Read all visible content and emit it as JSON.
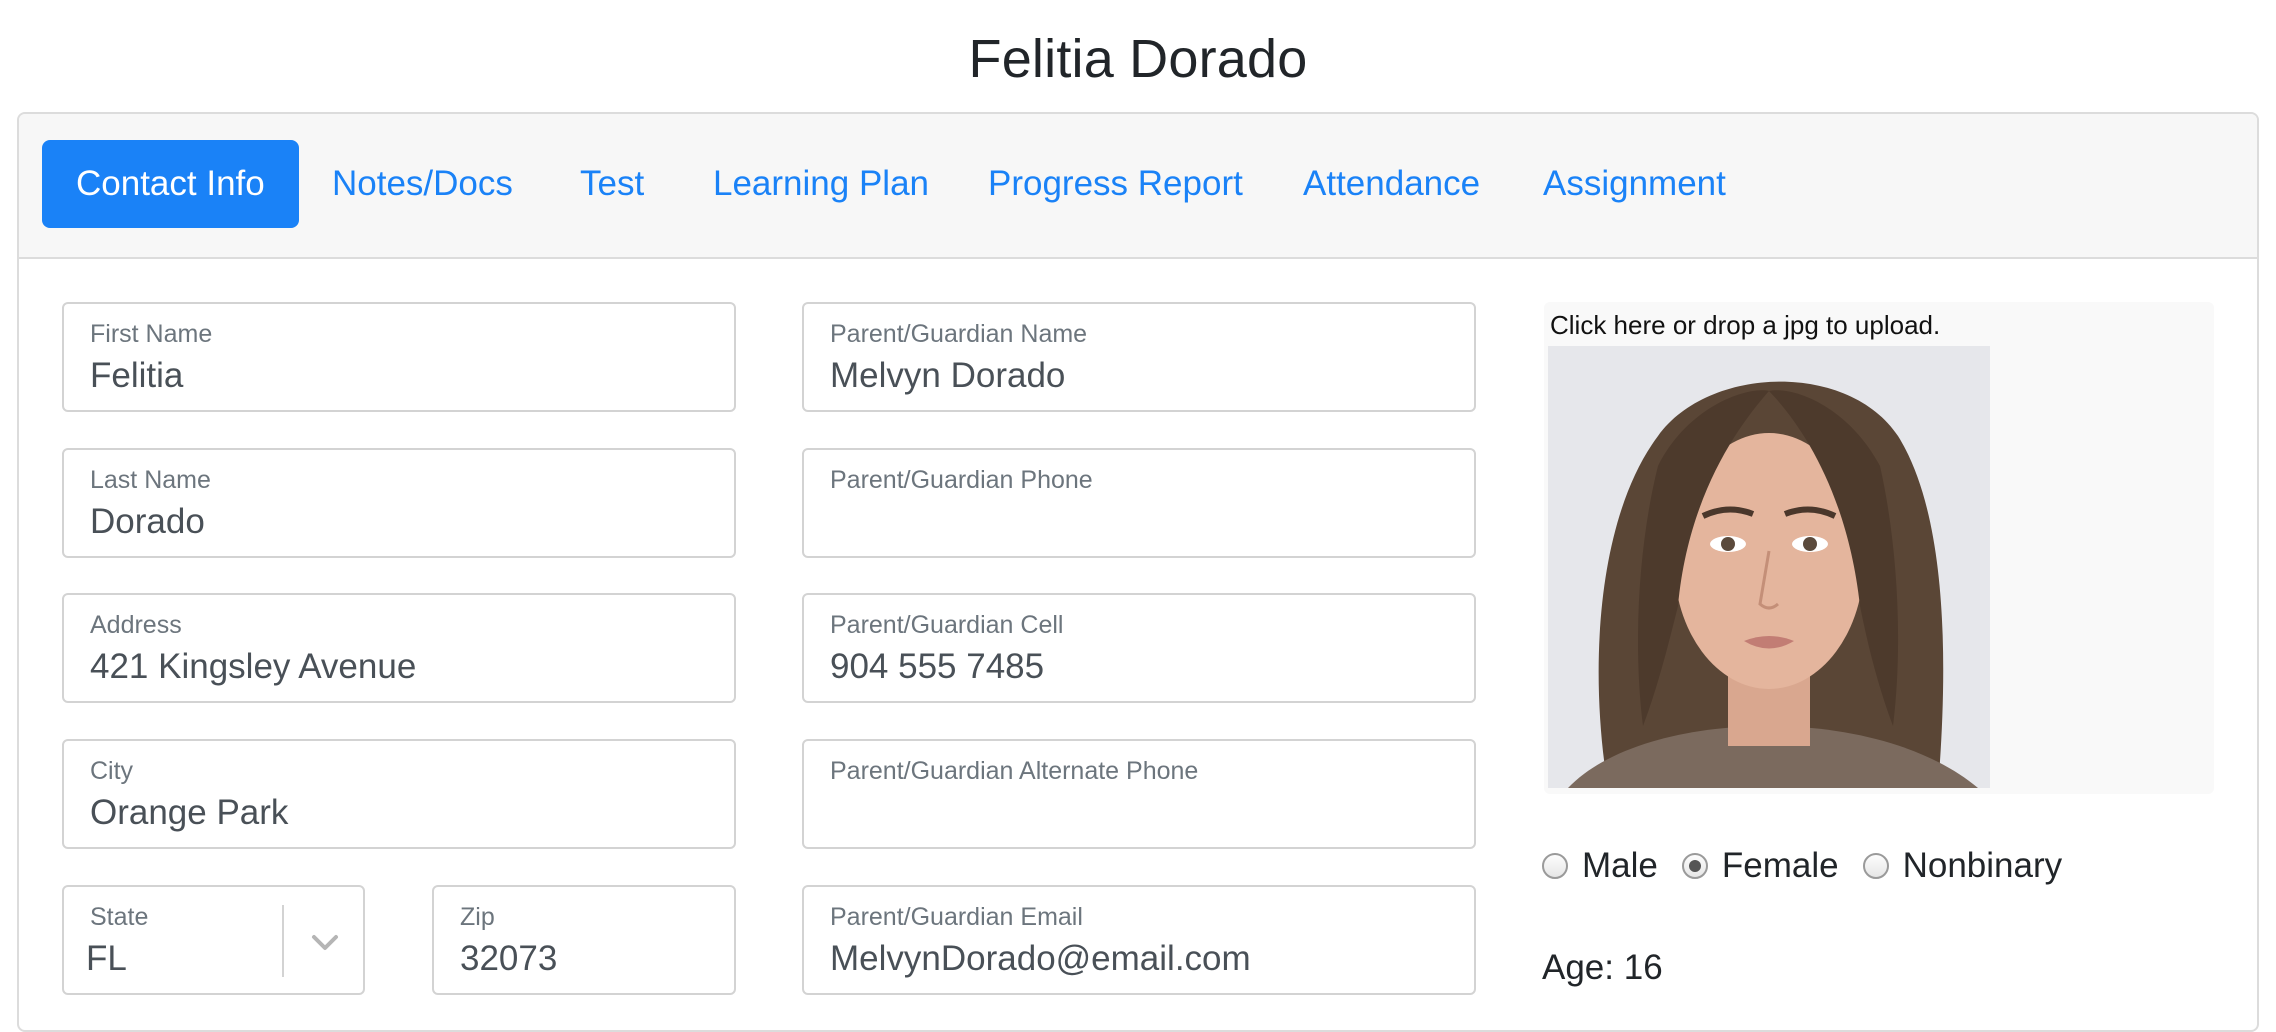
{
  "page_title": "Felitia Dorado",
  "tabs": [
    {
      "label": "Contact Info",
      "active": true
    },
    {
      "label": "Notes/Docs",
      "active": false
    },
    {
      "label": "Test",
      "active": false
    },
    {
      "label": "Learning Plan",
      "active": false
    },
    {
      "label": "Progress Report",
      "active": false
    },
    {
      "label": "Attendance",
      "active": false
    },
    {
      "label": "Assignment",
      "active": false
    }
  ],
  "student": {
    "first_name": {
      "label": "First Name",
      "value": "Felitia"
    },
    "last_name": {
      "label": "Last Name",
      "value": "Dorado"
    },
    "address": {
      "label": "Address",
      "value": "421 Kingsley Avenue"
    },
    "city": {
      "label": "City",
      "value": "Orange Park"
    },
    "state": {
      "label": "State",
      "value": "FL"
    },
    "zip": {
      "label": "Zip",
      "value": "32073"
    }
  },
  "guardian": {
    "name": {
      "label": "Parent/Guardian Name",
      "value": "Melvyn Dorado"
    },
    "phone": {
      "label": "Parent/Guardian Phone",
      "value": ""
    },
    "cell": {
      "label": "Parent/Guardian Cell",
      "value": "904 555 7485"
    },
    "alt_phone": {
      "label": "Parent/Guardian Alternate Phone",
      "value": ""
    },
    "email": {
      "label": "Parent/Guardian Email",
      "value": "MelvynDorado@email.com"
    }
  },
  "photo_upload": {
    "prompt": "Click here or drop a jpg to upload."
  },
  "gender": {
    "options": [
      "Male",
      "Female",
      "Nonbinary"
    ],
    "selected": "Female"
  },
  "age_text": "Age: 16",
  "colors": {
    "accent": "#1a82f7",
    "header_bg": "#f7f7f7",
    "border": "#d3d3d3"
  }
}
